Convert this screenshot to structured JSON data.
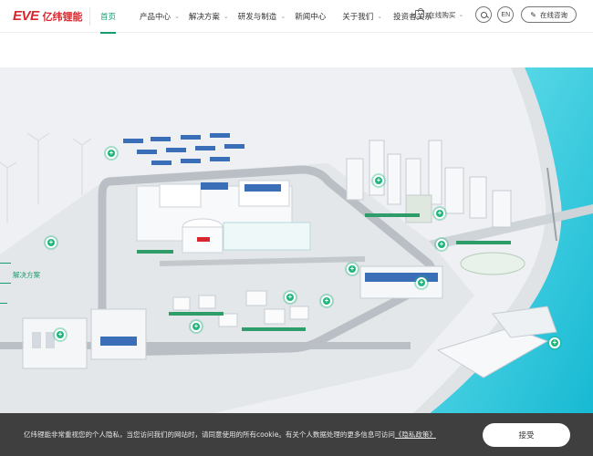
{
  "brand": {
    "logo_text": "EVE",
    "logo_cn": "亿纬锂能"
  },
  "nav": {
    "items": [
      {
        "label": "首页",
        "active": true,
        "dropdown": false
      },
      {
        "label": "产品中心",
        "active": false,
        "dropdown": true
      },
      {
        "label": "解决方案",
        "active": false,
        "dropdown": true
      },
      {
        "label": "研发与制造",
        "active": false,
        "dropdown": true
      },
      {
        "label": "新闻中心",
        "active": false,
        "dropdown": false
      },
      {
        "label": "关于我们",
        "active": false,
        "dropdown": true
      },
      {
        "label": "投资者关系",
        "active": false,
        "dropdown": false
      }
    ]
  },
  "header_right": {
    "shop_label": "在线购买",
    "lang_label": "EN",
    "consult_label": "在线咨询"
  },
  "hero": {
    "side_tag": "解决方案",
    "hotspot_symbol": "+"
  },
  "cookie": {
    "text": "亿纬锂能非常重视您的个人隐私，当您访问我们的网站时，请同意使用的所有cookie。有关个人数据处理的更多信息可访问",
    "link_text": "《隐私政策》",
    "accept_label": "接受"
  },
  "colors": {
    "accent": "#1a9d6e",
    "brand_red": "#d7262d",
    "cookie_bg": "#3f3f3f",
    "water": "#3fd0e0"
  }
}
